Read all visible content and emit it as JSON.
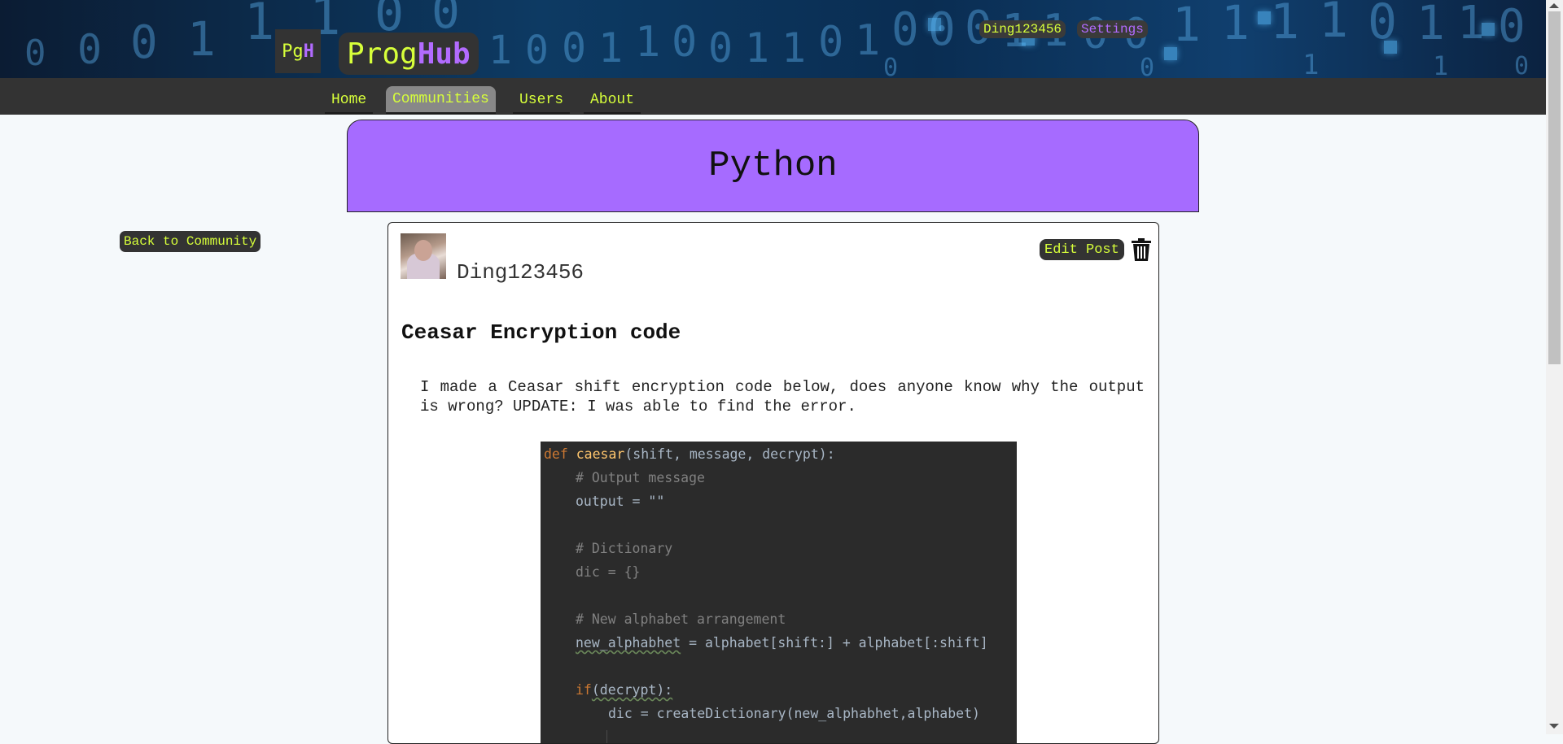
{
  "header": {
    "logo_small_prefix": "Pg",
    "logo_small_suffix": "H",
    "logo_prefix": "Prog",
    "logo_suffix": "Hub",
    "banner_digits": [
      "0",
      "0",
      "0",
      "1",
      "1",
      "1",
      "0",
      "0",
      "1",
      "0",
      "0",
      "1",
      "1",
      "0",
      "0",
      "1",
      "1",
      "0",
      "1",
      "0",
      "0",
      "0",
      "1",
      "1",
      "0",
      "0",
      "1",
      "1",
      "1",
      "1",
      "0",
      "1",
      "1",
      "0",
      "0",
      "0",
      "1",
      "1",
      "0"
    ],
    "username": "Ding123456",
    "settings_label": "Settings"
  },
  "nav": {
    "items": [
      {
        "label": "Home"
      },
      {
        "label": "Communities"
      },
      {
        "label": "Users"
      },
      {
        "label": "About"
      }
    ]
  },
  "community": {
    "name": "Python",
    "back_label": "Back to Community"
  },
  "post": {
    "author": "Ding123456",
    "edit_label": "Edit Post",
    "title": "Ceasar Encryption code",
    "body": "I made a Ceasar shift encryption code below, does anyone know why the output is wrong? UPDATE: I was able to find the error.",
    "code": {
      "line1_kw": "def",
      "line1_fn": "caesar",
      "line1_rest": "(shift, message, decrypt):",
      "line2": "# Output message",
      "line3": "output = \"\"",
      "line5": "# Dictionary",
      "line6": "dic = {}",
      "line8": "# New alphabet arrangement",
      "line9_var": "new_alphabhet",
      "line9_rest": " = alphabet[shift:] + alphabet[:shift]",
      "line11_kw": "if",
      "line11_arg": "(decrypt):",
      "line12": "dic = createDictionary(new_alphabhet,alphabet)"
    }
  },
  "colors": {
    "accent_green": "#d7ff3a",
    "accent_purple": "#b26bff",
    "community_bg": "#a66bff",
    "dark": "#333333"
  },
  "icons": {
    "trash": "trash-icon"
  }
}
